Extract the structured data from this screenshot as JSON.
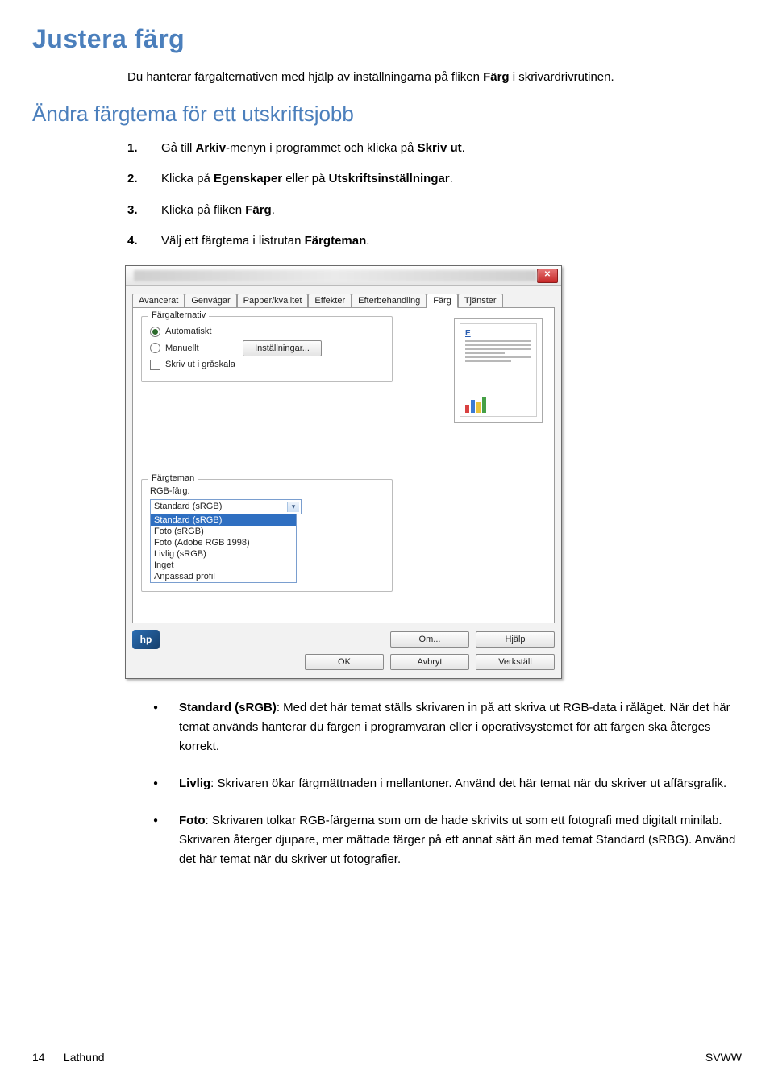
{
  "h1": "Justera färg",
  "intro_pre": "Du hanterar färgalternativen med hjälp av inställningarna på fliken ",
  "intro_bold": "Färg",
  "intro_post": " i skrivardrivrutinen.",
  "h2": "Ändra färgtema för ett utskriftsjobb",
  "steps": [
    {
      "n": "1.",
      "pre": "Gå till ",
      "b1": "Arkiv",
      "mid": "-menyn i programmet och klicka på ",
      "b2": "Skriv ut",
      "post": "."
    },
    {
      "n": "2.",
      "pre": "Klicka på ",
      "b1": "Egenskaper",
      "mid": " eller på ",
      "b2": "Utskriftsinställningar",
      "post": "."
    },
    {
      "n": "3.",
      "pre": "Klicka på fliken ",
      "b1": "Färg",
      "mid": "",
      "b2": "",
      "post": "."
    },
    {
      "n": "4.",
      "pre": "Välj ett färgtema i listrutan ",
      "b1": "Färgteman",
      "mid": "",
      "b2": "",
      "post": "."
    }
  ],
  "dialog": {
    "tabs": [
      "Avancerat",
      "Genvägar",
      "Papper/kvalitet",
      "Effekter",
      "Efterbehandling",
      "Färg",
      "Tjänster"
    ],
    "active_tab": 5,
    "group1": {
      "title": "Färgalternativ",
      "auto": "Automatiskt",
      "manual": "Manuellt",
      "settings_btn": "Inställningar...",
      "gray": "Skriv ut i gråskala"
    },
    "group2": {
      "title": "Färgteman",
      "label": "RGB-färg:",
      "selected": "Standard (sRGB)",
      "options": [
        "Standard (sRGB)",
        "Foto (sRGB)",
        "Foto (Adobe RGB 1998)",
        "Livlig (sRGB)",
        "Inget",
        "Anpassad profil"
      ]
    },
    "hp": "hp",
    "btn_om": "Om...",
    "btn_hjalp": "Hjälp",
    "btn_ok": "OK",
    "btn_avbryt": "Avbryt",
    "btn_verkstall": "Verkställ"
  },
  "bullets": [
    {
      "b": "Standard (sRGB)",
      "t": ": Med det här temat ställs skrivaren in på att skriva ut RGB-data i råläget. När det här temat används hanterar du färgen i programvaran eller i operativsystemet för att färgen ska återges korrekt."
    },
    {
      "b": "Livlig",
      "t": ": Skrivaren ökar färgmättnaden i mellantoner. Använd det här temat när du skriver ut affärsgrafik."
    },
    {
      "b": "Foto",
      "t": ": Skrivaren tolkar RGB-färgerna som om de hade skrivits ut som ett fotografi med digitalt minilab. Skrivaren återger djupare, mer mättade färger på ett annat sätt än med temat Standard (sRBG). Använd det här temat när du skriver ut fotografier."
    }
  ],
  "footer": {
    "left_num": "14",
    "left_txt": "Lathund",
    "right": "SVWW"
  }
}
